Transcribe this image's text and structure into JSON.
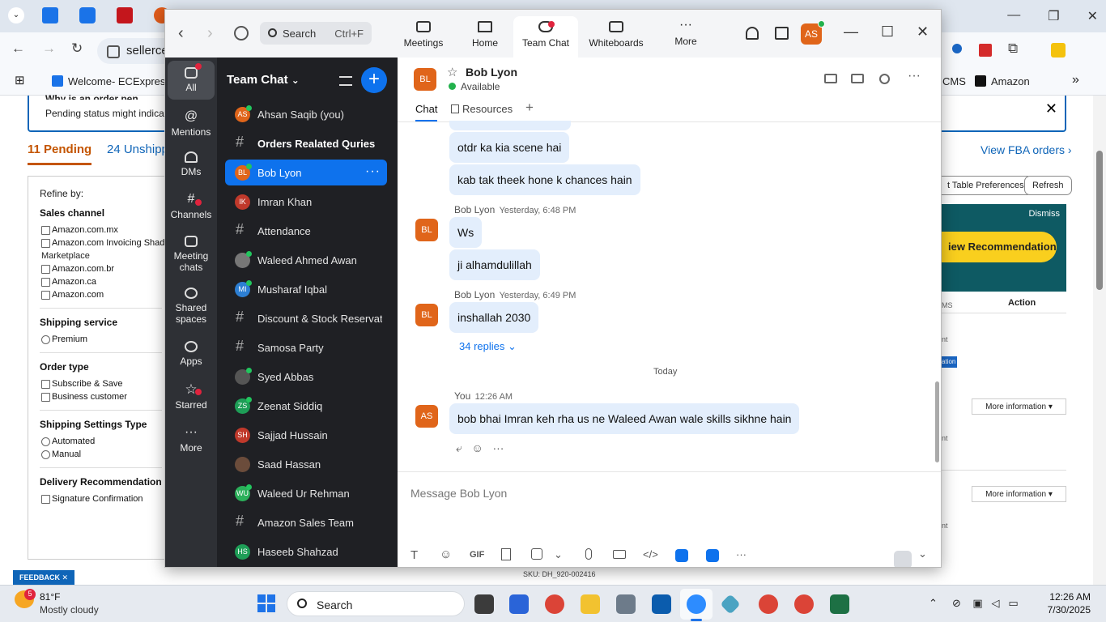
{
  "browser": {
    "address_text": "sellerce",
    "bookmarks": [
      "Welcome- ECExpres...",
      "CMS",
      "Amazon"
    ],
    "page": {
      "alert_text": "Pending status might indicate a",
      "alert_heading_partial": "Why is an order pen",
      "tab_pending": "11 Pending",
      "tab_unshipped": "24 Unshippe",
      "refine_by": "Refine by:",
      "filters": [
        {
          "title": "Sales channel",
          "kind": "checkbox",
          "options": [
            "Amazon.com.mx",
            "Amazon.com Invoicing Shado",
            "Marketplace",
            "Amazon.com.br",
            "Amazon.ca",
            "Amazon.com"
          ]
        },
        {
          "title": "Shipping service",
          "kind": "radio",
          "options": [
            "Premium"
          ]
        },
        {
          "title": "Order type",
          "kind": "checkbox",
          "options": [
            "Subscribe & Save",
            "Business customer"
          ]
        },
        {
          "title": "Shipping Settings Type",
          "kind": "radio",
          "options": [
            "Automated",
            "Manual"
          ]
        },
        {
          "title": "Delivery Recommendation",
          "kind": "checkbox",
          "options": [
            "Signature Confirmation"
          ]
        }
      ],
      "view_fba": "View FBA orders ›",
      "table_prefs_btn": "t Table Preferences",
      "refresh_btn": "Refresh",
      "dismiss": "Dismiss",
      "recommend_btn": "iew Recommendations",
      "action_header": "Action",
      "more_info": "More information ▾",
      "highlight_text": "ation",
      "fragment_nt": "nt",
      "fragment_ms": "MS",
      "sku": "SKU: DH_920-002416",
      "feedback": "FEEDBACK ✕"
    }
  },
  "zoom": {
    "search_label": "Search",
    "search_shortcut": "Ctrl+F",
    "top_tabs": [
      "Meetings",
      "Home",
      "Team Chat",
      "Whiteboards",
      "More"
    ],
    "user_initials": "AS",
    "rail": [
      "All",
      "Mentions",
      "DMs",
      "Channels",
      "Meeting chats",
      "Shared spaces",
      "Apps",
      "Starred",
      "More"
    ],
    "list_title": "Team Chat",
    "list_title_caret": "⌄",
    "channels": [
      {
        "name": "Ahsan Saqib (you)",
        "type": "dm",
        "initials": "AS",
        "color": "#e0651a",
        "presence": true
      },
      {
        "name": "Orders Realated Quries",
        "type": "channel",
        "bold": true
      },
      {
        "name": "Bob Lyon",
        "type": "dm",
        "initials": "BL",
        "color": "#e0651a",
        "presence": true,
        "selected": true
      },
      {
        "name": "Imran Khan",
        "type": "dm",
        "initials": "IK",
        "color": "#c0392b"
      },
      {
        "name": "Attendance",
        "type": "channel"
      },
      {
        "name": "Waleed Ahmed Awan",
        "type": "dm",
        "initials": "",
        "color": "#777",
        "presence": true
      },
      {
        "name": "Musharaf Iqbal",
        "type": "dm",
        "initials": "MI",
        "color": "#2d7fd3",
        "presence": true
      },
      {
        "name": "Discount & Stock Reservati...",
        "type": "channel"
      },
      {
        "name": "Samosa Party",
        "type": "channel"
      },
      {
        "name": "Syed Abbas",
        "type": "dm",
        "initials": "",
        "color": "#555",
        "presence": true
      },
      {
        "name": "Zeenat Siddiq",
        "type": "dm",
        "initials": "ZS",
        "color": "#1e9e57",
        "presence": true
      },
      {
        "name": "Sajjad Hussain",
        "type": "dm",
        "initials": "SH",
        "color": "#c0392b"
      },
      {
        "name": "Saad Hassan",
        "type": "dm",
        "initials": "",
        "color": "#6b4c3b"
      },
      {
        "name": "Waleed Ur Rehman",
        "type": "dm",
        "initials": "WU",
        "color": "#2bb05a",
        "presence": true
      },
      {
        "name": "Amazon Sales Team",
        "type": "channel"
      },
      {
        "name": "Haseeb Shahzad",
        "type": "dm",
        "initials": "HS",
        "color": "#1e9e57"
      }
    ],
    "chat": {
      "initials": "BL",
      "name": "Bob Lyon",
      "status": "Available",
      "tab_chat": "Chat",
      "tab_resources": "Resources",
      "bubbles_top": [
        "otdr ka kia scene hai",
        "kab tak theek hone k chances hain"
      ],
      "group1_sender": "Bob Lyon",
      "group1_time": "Yesterday, 6:48 PM",
      "group1_bubbles": [
        "Ws",
        "ji alhamdulillah"
      ],
      "group2_sender": "Bob Lyon",
      "group2_time": "Yesterday, 6:49 PM",
      "group2_bubble": "inshallah 2030",
      "replies": "34 replies ⌄",
      "date_separator": "Today",
      "group3_sender": "You",
      "group3_time": "12:26 AM",
      "group3_initials": "AS",
      "group3_bubble": "bob bhai Imran keh rha us ne Waleed Awan wale skills sikhne hain",
      "compose_placeholder": "Message Bob Lyon",
      "gif_label": "GIF"
    }
  },
  "taskbar": {
    "weather_badge": "5",
    "temperature": "81°F",
    "condition": "Mostly cloudy",
    "search": "Search",
    "time": "12:26 AM",
    "date": "7/30/2025"
  }
}
